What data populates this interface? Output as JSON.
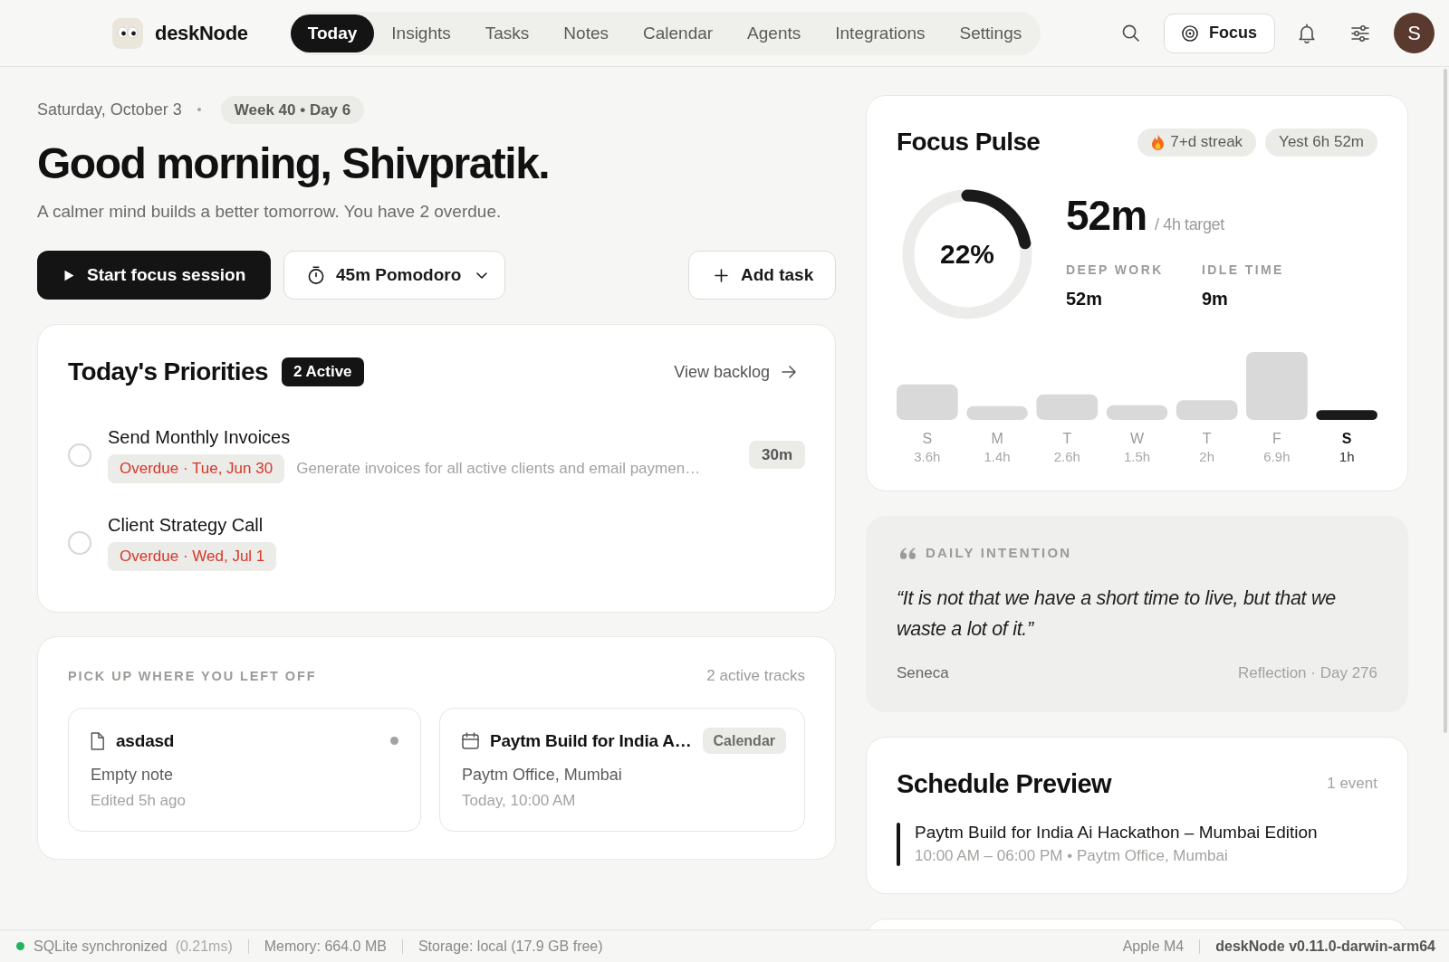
{
  "app": {
    "name": "deskNode"
  },
  "nav": {
    "tabs": [
      {
        "label": "Today",
        "selected": true
      },
      {
        "label": "Insights",
        "selected": false
      },
      {
        "label": "Tasks",
        "selected": false
      },
      {
        "label": "Notes",
        "selected": false
      },
      {
        "label": "Calendar",
        "selected": false
      },
      {
        "label": "Agents",
        "selected": false
      },
      {
        "label": "Integrations",
        "selected": false
      },
      {
        "label": "Settings",
        "selected": false
      }
    ]
  },
  "toolbar": {
    "focus_button": "Focus",
    "avatar": "S"
  },
  "header": {
    "date": "Saturday, October 3",
    "week": "Week 40 • Day 6",
    "greeting": "Good morning, Shivpratik.",
    "subtitle": "A calmer mind builds a better tomorrow. You have 2 overdue."
  },
  "actions": {
    "start_button": "Start focus session",
    "timer_button": "45m Pomodoro",
    "add_button": "Add task"
  },
  "priorities": {
    "title": "Today's Priorities",
    "badge": "2 Active",
    "link": "View backlog",
    "tasks": [
      {
        "title": "Send Monthly Invoices",
        "checked": false,
        "due": "Overdue · Tue, Jun 30",
        "description": "Generate invoices for all active clients and email paymen…",
        "estimate": "30m"
      },
      {
        "title": "Client Strategy Call",
        "checked": false,
        "due": "Overdue · Wed, Jul 1"
      }
    ]
  },
  "pickup": {
    "title": "PICK UP WHERE YOU LEFT OFF",
    "count": "2 active tracks",
    "items": [
      {
        "kind": "note",
        "title": "asdasd",
        "indicator": true,
        "detail": "Empty note",
        "time": "Edited 5h ago"
      },
      {
        "kind": "event",
        "title": "Paytm Build for India A…",
        "tag": "Calendar",
        "detail": "Paytm Office, Mumbai",
        "time": "Today, 10:00 AM"
      }
    ]
  },
  "focus_pulse": {
    "title": "Focus Pulse",
    "chips": [
      {
        "kind": "streak",
        "label": "7+d streak"
      },
      {
        "kind": "plain",
        "label": "Yest 6h 52m"
      }
    ],
    "ring": {
      "level": 0.22,
      "label": "22%"
    },
    "total": "52m",
    "target": "/ 4h target",
    "stats": [
      {
        "label": "DEEP WORK",
        "value": "52m"
      },
      {
        "label": "IDLE TIME",
        "value": "9m"
      }
    ],
    "chart_data": {
      "type": "bar",
      "categories": [
        "S",
        "M",
        "T",
        "W",
        "T",
        "F",
        "S"
      ],
      "values": [
        3.6,
        1.4,
        2.6,
        1.5,
        2,
        6.9,
        1
      ],
      "colors": [
        "#d9d9d9",
        "#d9d9d9",
        "#d9d9d9",
        "#d9d9d9",
        "#d9d9d9",
        "#d9d9d9",
        "#1a1a1a"
      ],
      "value_labels": [
        "3.6h",
        "1.4h",
        "2.6h",
        "1.5h",
        "2h",
        "6.9h",
        "1h"
      ]
    }
  },
  "intention": {
    "label": "DAILY INTENTION",
    "quote": "“It is not that we have a short time to live, but that we waste a lot of it.”",
    "author": "Seneca",
    "meta": "Reflection · Day 276"
  },
  "schedule": {
    "title": "Schedule Preview",
    "count": "1 event",
    "events": [
      {
        "title": "Paytm Build for India Ai Hackathon – Mumbai Edition",
        "details": "10:00 AM – 06:00 PM • Paytm Office, Mumbai"
      }
    ]
  },
  "status_bar": {
    "left": [
      {
        "kind": "sync",
        "label": "SQLite synchronized",
        "detail": "(0.21ms)",
        "synced": true
      },
      {
        "kind": "text",
        "label": "Memory: 664.0 MB"
      },
      {
        "kind": "text",
        "label": "Storage: local (17.9 GB free)"
      }
    ],
    "right": [
      {
        "kind": "text",
        "label": "Apple M4"
      },
      {
        "kind": "strong",
        "label": "deskNode v0.11.0-darwin-arm64"
      }
    ]
  }
}
